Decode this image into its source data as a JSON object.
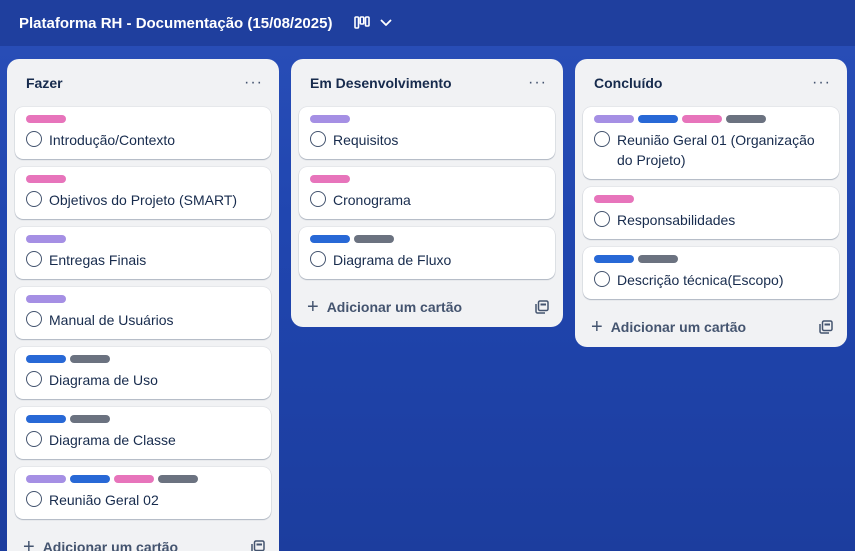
{
  "board": {
    "title": "Plataforma RH - Documentação (15/08/2025)",
    "view_icon": "board-view-icon",
    "dropdown_icon": "chevron-down-icon"
  },
  "colors": {
    "purple": "#a58fe4",
    "pink": "#e774bb",
    "blue": "#2868d6",
    "gray": "#6b7280"
  },
  "lists": [
    {
      "title": "Fazer",
      "menu": "···",
      "add_label": "Adicionar um cartão",
      "cards": [
        {
          "title": "Introdução/Contexto",
          "labels": [
            "pink"
          ]
        },
        {
          "title": "Objetivos do Projeto (SMART)",
          "labels": [
            "pink"
          ]
        },
        {
          "title": "Entregas Finais",
          "labels": [
            "purple"
          ]
        },
        {
          "title": "Manual de Usuários",
          "labels": [
            "purple"
          ]
        },
        {
          "title": "Diagrama de Uso",
          "labels": [
            "blue",
            "gray"
          ]
        },
        {
          "title": "Diagrama de Classe",
          "labels": [
            "blue",
            "gray"
          ]
        },
        {
          "title": "Reunião Geral 02",
          "labels": [
            "purple",
            "blue",
            "pink",
            "gray"
          ]
        }
      ]
    },
    {
      "title": "Em Desenvolvimento",
      "menu": "···",
      "add_label": "Adicionar um cartão",
      "cards": [
        {
          "title": "Requisitos",
          "labels": [
            "purple"
          ]
        },
        {
          "title": "Cronograma",
          "labels": [
            "pink"
          ]
        },
        {
          "title": "Diagrama de Fluxo",
          "labels": [
            "blue",
            "gray"
          ]
        }
      ]
    },
    {
      "title": "Concluído",
      "menu": "···",
      "add_label": "Adicionar um cartão",
      "cards": [
        {
          "title": "Reunião Geral 01 (Organização do Projeto)",
          "labels": [
            "purple",
            "blue",
            "pink",
            "gray"
          ]
        },
        {
          "title": "Responsabilidades",
          "labels": [
            "pink"
          ]
        },
        {
          "title": "Descrição técnica(Escopo)",
          "labels": [
            "blue",
            "gray"
          ]
        }
      ]
    }
  ]
}
